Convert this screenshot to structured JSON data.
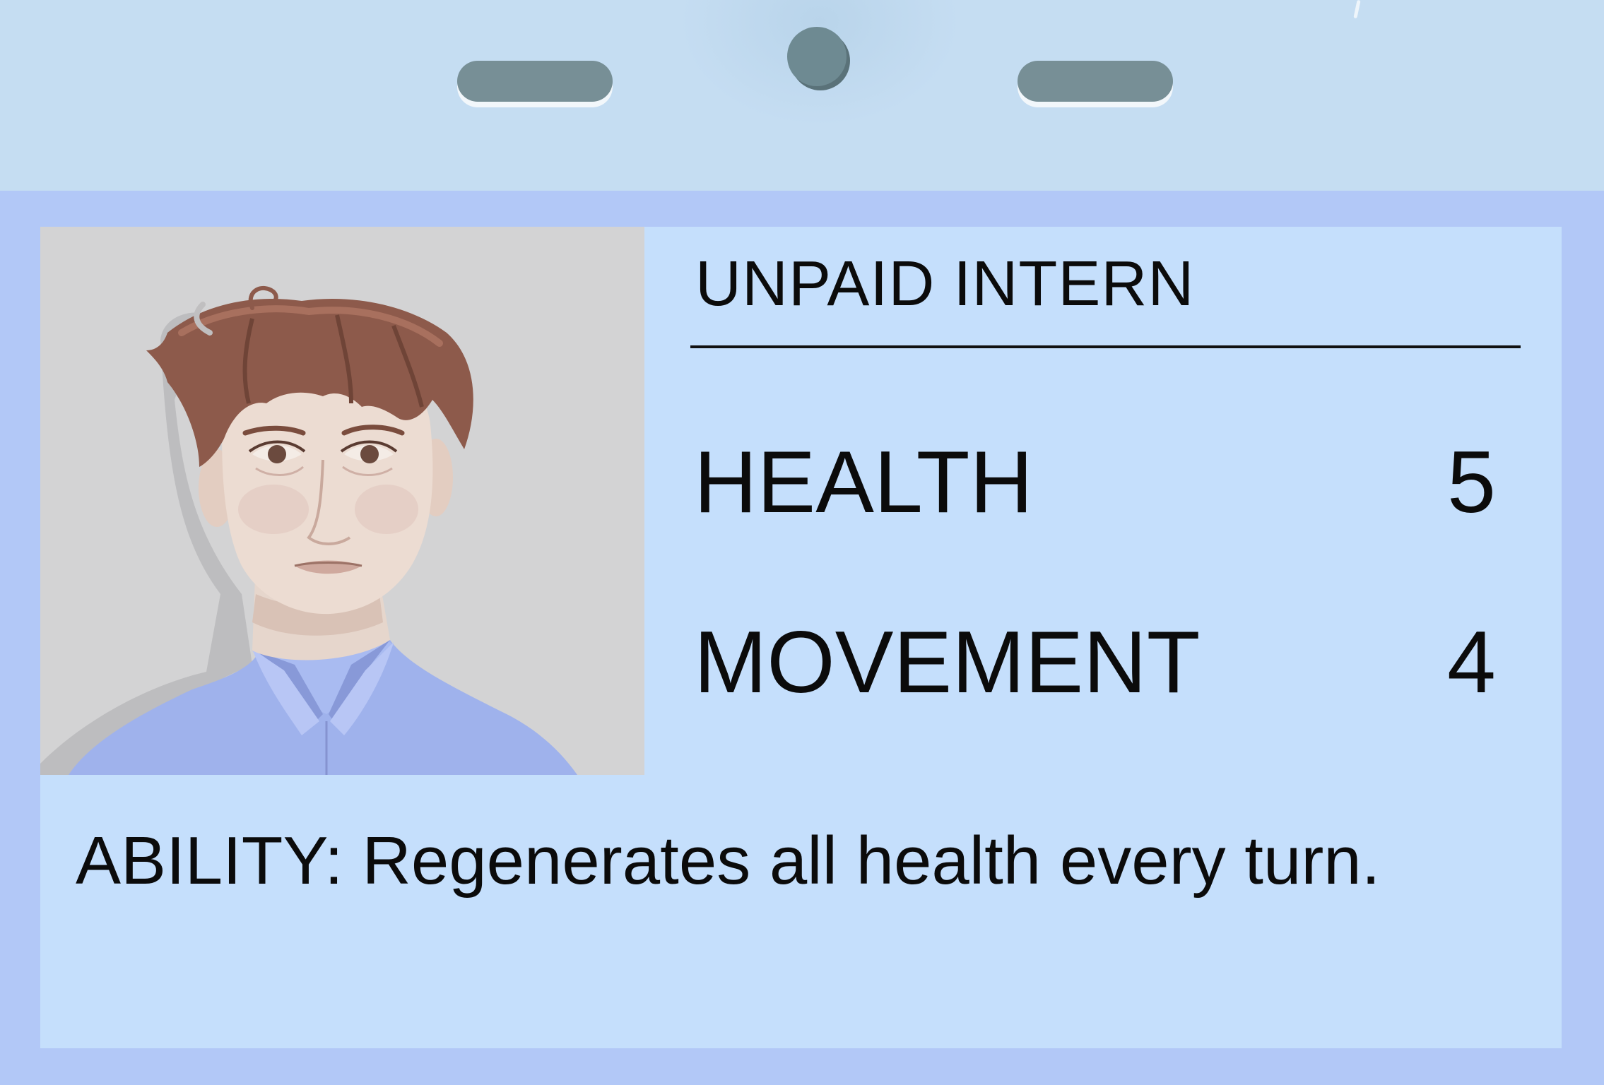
{
  "card": {
    "name": "UNPAID INTERN",
    "stats": {
      "health": {
        "label": "HEALTH",
        "value": "5"
      },
      "movement": {
        "label": "MOVEMENT",
        "value": "4"
      }
    },
    "ability": "ABILITY: Regenerates all health every turn."
  },
  "colors": {
    "badge_border": "#b2c8f7",
    "clip_background": "#c5ddf2",
    "card_background": "#c5dffc",
    "portrait_background": "#d3d3d4",
    "text": "#0b0b0b"
  }
}
